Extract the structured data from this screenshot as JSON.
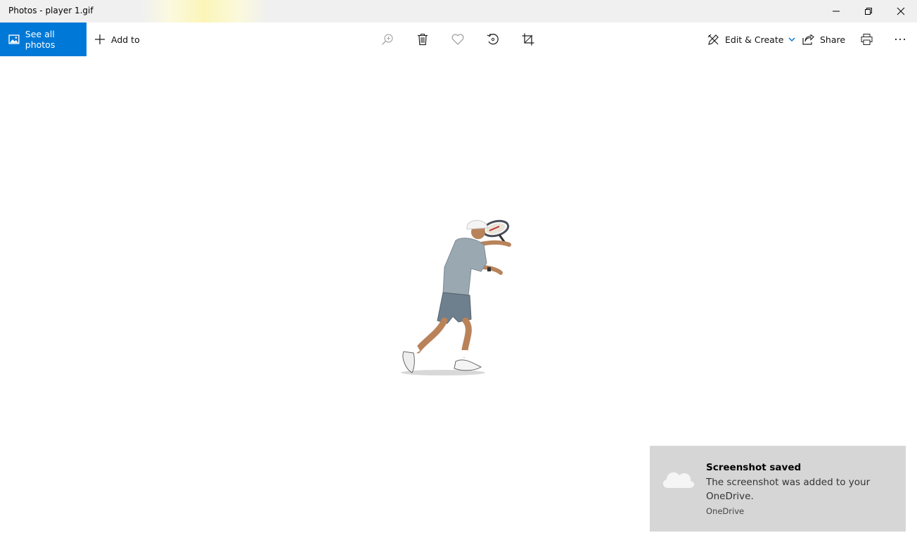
{
  "window": {
    "title": "Photos - player 1.gif",
    "controls": {
      "minimize": "minimize-icon",
      "restore": "restore-icon",
      "close": "close-icon"
    }
  },
  "toolbar": {
    "see_all_label": "See all photos",
    "add_to_label": "Add to",
    "edit_create_label": "Edit & Create",
    "share_label": "Share",
    "icons": [
      "picture-icon",
      "plus-icon",
      "zoom-in-icon",
      "delete-icon",
      "favorite-icon",
      "rotate-icon",
      "crop-icon",
      "edit-icon",
      "share-icon",
      "print-icon",
      "more-icon"
    ],
    "accent": "#0078d7"
  },
  "photo": {
    "subject": "tennis player",
    "file": "player 1.gif"
  },
  "toast": {
    "title": "Screenshot saved",
    "body": "The screenshot was added to your OneDrive.",
    "source": "OneDrive",
    "background": "#d6d6d6"
  }
}
